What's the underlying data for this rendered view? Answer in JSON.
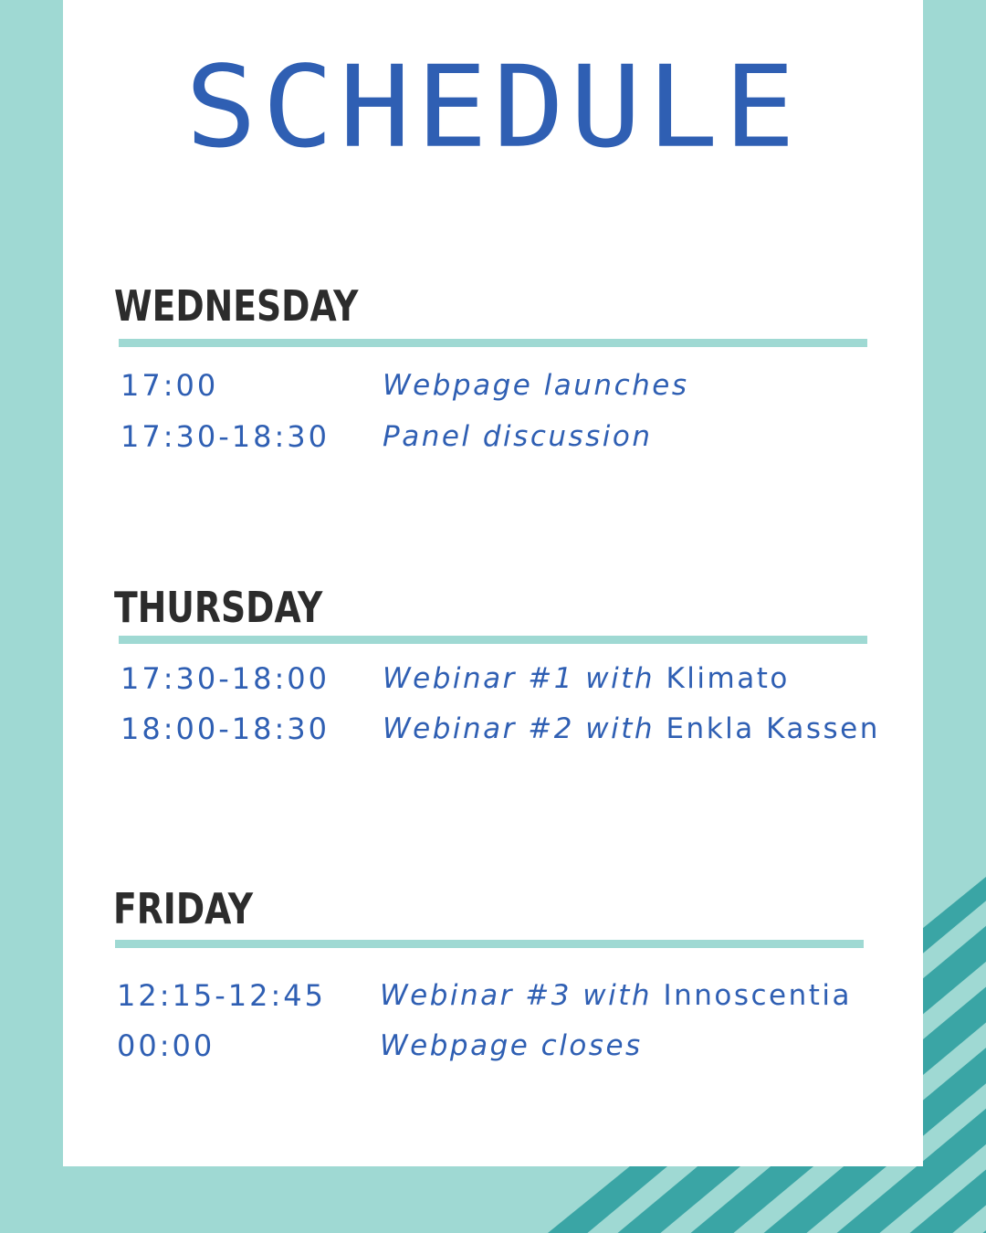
{
  "title": "SCHEDULE",
  "colors": {
    "background": "#9fd9d3",
    "card": "#ffffff",
    "accent_blue": "#2f5fb3",
    "heading_dark": "#2c2c2c",
    "stripe": "#3aa5a5"
  },
  "days": [
    {
      "name": "WEDNESDAY",
      "events": [
        {
          "time": "17:00",
          "desc": "Webpage launches",
          "guest": ""
        },
        {
          "time": "17:30-18:30",
          "desc": "Panel discussion",
          "guest": ""
        }
      ]
    },
    {
      "name": "THURSDAY",
      "events": [
        {
          "time": "17:30-18:00",
          "desc": "Webinar #1 with",
          "guest": "Klimato"
        },
        {
          "time": "18:00-18:30",
          "desc": "Webinar #2 with",
          "guest": "Enkla Kassen"
        }
      ]
    },
    {
      "name": "FRIDAY",
      "events": [
        {
          "time": "12:15-12:45",
          "desc": "Webinar #3 with",
          "guest": "Innoscentia"
        },
        {
          "time": "00:00",
          "desc": "Webpage closes",
          "guest": ""
        }
      ]
    }
  ]
}
